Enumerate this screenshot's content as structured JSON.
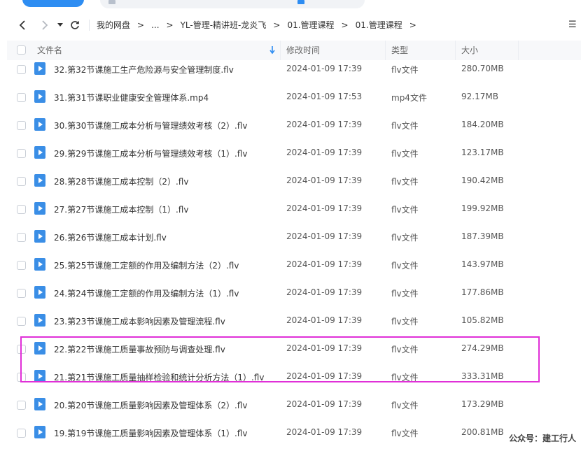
{
  "nav": {
    "back_icon": "chevron-left-icon",
    "forward_icon": "chevron-right-icon",
    "history_icon": "caret-down-icon",
    "refresh_icon": "refresh-icon",
    "view_icon": "list-view-icon",
    "breadcrumbs": [
      "我的网盘",
      "...",
      "YL-管理-精讲班-龙炎飞",
      "01.管理课程",
      "01.管理课程"
    ]
  },
  "header": {
    "name": "文件名",
    "modified": "修改时间",
    "type": "类型",
    "size": "大小",
    "sort_icon": "sort-down-arrow-icon"
  },
  "files": [
    {
      "name": "32.第32节课施工生产危险源与安全管理制度.flv",
      "modified": "2024-01-09 17:39",
      "type": "flv文件",
      "size": "280.70MB"
    },
    {
      "name": "31.第31节课职业健康安全管理体系.mp4",
      "modified": "2024-01-09 17:53",
      "type": "mp4文件",
      "size": "92.17MB"
    },
    {
      "name": "30.第30节课施工成本分析与管理绩效考核（2）.flv",
      "modified": "2024-01-09 17:39",
      "type": "flv文件",
      "size": "184.20MB"
    },
    {
      "name": "29.第29节课施工成本分析与管理绩效考核（1）.flv",
      "modified": "2024-01-09 17:39",
      "type": "flv文件",
      "size": "123.17MB"
    },
    {
      "name": "28.第28节课施工成本控制（2）.flv",
      "modified": "2024-01-09 17:39",
      "type": "flv文件",
      "size": "190.42MB"
    },
    {
      "name": "27.第27节课施工成本控制（1）.flv",
      "modified": "2024-01-09 17:39",
      "type": "flv文件",
      "size": "199.92MB"
    },
    {
      "name": "26.第26节课施工成本计划.flv",
      "modified": "2024-01-09 17:39",
      "type": "flv文件",
      "size": "187.39MB"
    },
    {
      "name": "25.第25节课施工定额的作用及编制方法（2）.flv",
      "modified": "2024-01-09 17:39",
      "type": "flv文件",
      "size": "143.97MB"
    },
    {
      "name": "24.第24节课施工定额的作用及编制方法（1）.flv",
      "modified": "2024-01-09 17:39",
      "type": "flv文件",
      "size": "177.86MB"
    },
    {
      "name": "23.第23节课施工成本影响因素及管理流程.flv",
      "modified": "2024-01-09 17:39",
      "type": "flv文件",
      "size": "105.82MB"
    },
    {
      "name": "22.第22节课施工质量事故预防与调查处理.flv",
      "modified": "2024-01-09 17:39",
      "type": "flv文件",
      "size": "274.29MB"
    },
    {
      "name": "21.第21节课施工质量抽样检验和统计分析方法（1）.flv",
      "modified": "2024-01-09 17:39",
      "type": "flv文件",
      "size": "333.31MB"
    },
    {
      "name": "20.第20节课施工质量影响因素及管理体系（2）.flv",
      "modified": "2024-01-09 17:39",
      "type": "flv文件",
      "size": "173.29MB"
    },
    {
      "name": "19.第19节课施工质量影响因素及管理体系（1）.flv",
      "modified": "2024-01-09 17:39",
      "type": "flv文件",
      "size": "200.81MB"
    }
  ],
  "watermark": "公众号：建工行人",
  "colors": {
    "accent": "#2e8df2",
    "file_icon": "#3a8ee6",
    "highlight": "#e030d8"
  }
}
